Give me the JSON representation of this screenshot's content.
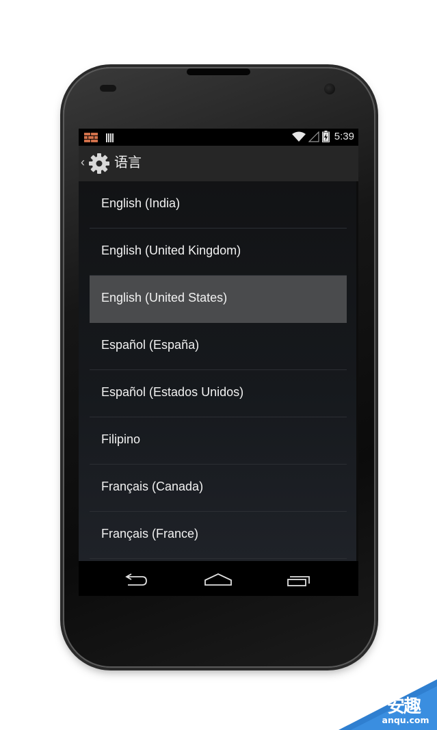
{
  "status_bar": {
    "time": "5:39",
    "icons": [
      "notification-brick-icon",
      "signal-bars-icon",
      "wifi-icon",
      "cell-signal-icon",
      "battery-charging-icon"
    ]
  },
  "action_bar": {
    "title": "语言",
    "up_icon": "chevron-left-icon",
    "app_icon": "settings-gear-icon"
  },
  "languages": [
    {
      "label": "English (India)",
      "selected": false
    },
    {
      "label": "English (United Kingdom)",
      "selected": false
    },
    {
      "label": "English (United States)",
      "selected": true
    },
    {
      "label": "Español (España)",
      "selected": false
    },
    {
      "label": "Español (Estados Unidos)",
      "selected": false
    },
    {
      "label": "Filipino",
      "selected": false
    },
    {
      "label": "Français (Canada)",
      "selected": false
    },
    {
      "label": "Français (France)",
      "selected": false
    }
  ],
  "nav_bar": {
    "buttons": [
      "back-icon",
      "home-icon",
      "recent-apps-icon"
    ]
  },
  "watermark": {
    "brand_cn": "安趣",
    "domain": "anqu.com"
  },
  "colors": {
    "selected_row": "#4a4b4d",
    "action_bar": "#262626",
    "text": "#f2f2f2",
    "watermark_blue": "#2f7fd0"
  }
}
